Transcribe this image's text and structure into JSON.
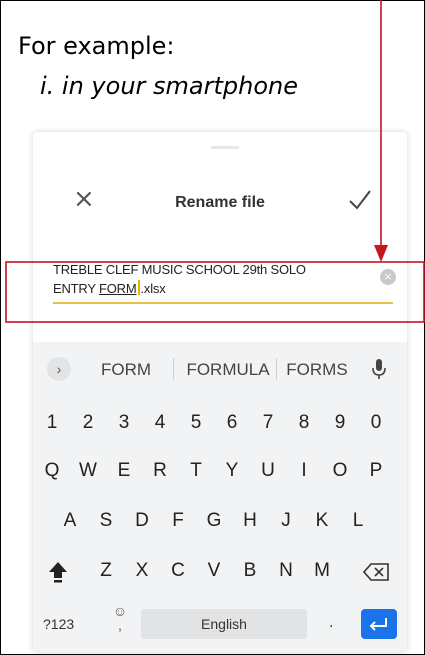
{
  "caption": {
    "line1": "For example:",
    "line2": "i.  in your smartphone"
  },
  "colors": {
    "annotation_red": "#c4161c",
    "cursor_yellow": "#e7b400",
    "enter_blue": "#1a73e8"
  },
  "dialog": {
    "close_icon": "close-icon",
    "title": "Rename file",
    "confirm_icon": "check-icon"
  },
  "filename_input": {
    "line1": "TREBLE CLEF MUSIC SCHOOL 29th SOLO",
    "line2_prefix": "ENTRY ",
    "line2_underlined": "FORM",
    "line2_suffix": ".xlsx",
    "clear_icon": "clear-icon"
  },
  "keyboard": {
    "suggestions": [
      "FORM",
      "FORMULA",
      "FORMS"
    ],
    "row1": [
      "1",
      "2",
      "3",
      "4",
      "5",
      "6",
      "7",
      "8",
      "9",
      "0"
    ],
    "row2": [
      "Q",
      "W",
      "E",
      "R",
      "T",
      "Y",
      "U",
      "I",
      "O",
      "P"
    ],
    "row3": [
      "A",
      "S",
      "D",
      "F",
      "G",
      "H",
      "J",
      "K",
      "L"
    ],
    "row4": [
      "Z",
      "X",
      "C",
      "V",
      "B",
      "N",
      "M"
    ],
    "symbols_label": "?123",
    "emoji_comma_label": ",",
    "space_label": "English",
    "period_label": "."
  }
}
